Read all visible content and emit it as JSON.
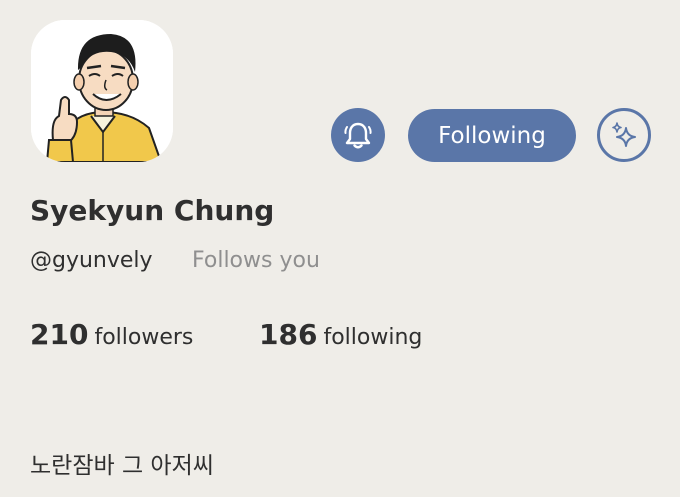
{
  "profile": {
    "name": "Syekyun Chung",
    "handle": "@gyunvely",
    "follows_you": "Follows you",
    "bio": "노란잠바 그 아저씨"
  },
  "actions": {
    "notify_icon": "bell-icon",
    "follow_label": "Following",
    "sparkle_icon": "sparkles-icon"
  },
  "stats": {
    "followers_count": "210",
    "followers_label": "followers",
    "following_count": "186",
    "following_label": "following"
  },
  "colors": {
    "background": "#efede8",
    "accent": "#5a76a8",
    "text": "#2f2f2f",
    "muted": "#8f8f8f"
  }
}
